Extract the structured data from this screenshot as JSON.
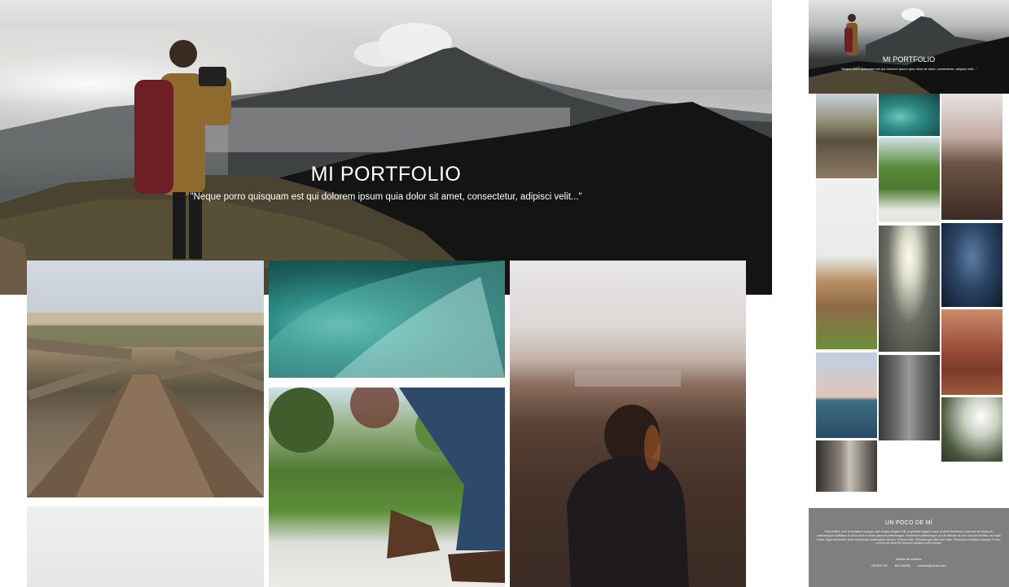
{
  "hero": {
    "title": "MI PORTFOLIO",
    "subtitle": "\"Neque porro quisquam est qui dolorem ipsum quia dolor sit amet, consectetur, adipisci velit...\""
  },
  "preview": {
    "title": "MI PORTFOLIO",
    "subtitle": "\"Neque porro quisquam est qui dolorem ipsum quia dolor sit amet, consectetur, adipisci velit...\"",
    "about": {
      "title": "UN POCO DE MÍ",
      "body": "Pain thrilled, pain la lamaissa lauvaya, pain magna feugiat velit, et gravida magna neque at amet fermentum placerat vel turpis per pellentesque habitasse in dolor sit et et lacus placerat pellentesque. Vestibulum pellentesque orci et ultricies ac arcu sed dui facilisis, sed eget turpis. Eget elementum ante ullamcorper malesuada ultricies. Pretium nibh. Pellentesque diam sed vitae. Phasellus et tempor volutpat. Donec a lorem sit amet leo rhoncus tincidunt nulla cursus.",
      "contact_title": "Medios de contacto",
      "contacts": [
        "NICOLE NA",
        "604 000000",
        "tucorreo@correo.com"
      ]
    }
  },
  "photos": [
    {
      "name": "boardwalk-photo"
    },
    {
      "name": "wave-photo"
    },
    {
      "name": "walking-legs-photo"
    },
    {
      "name": "sunset-person-photo"
    },
    {
      "name": "wheat-field-photo"
    }
  ]
}
